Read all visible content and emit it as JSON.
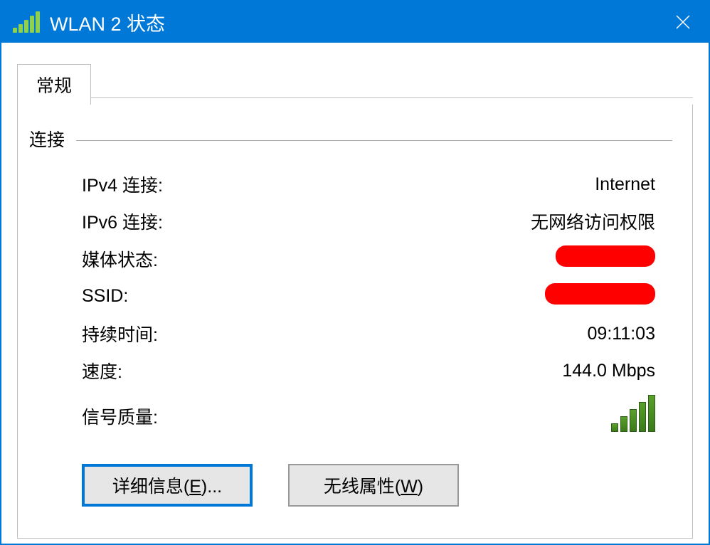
{
  "title": "WLAN 2 状态",
  "tab": {
    "general": "常规"
  },
  "section": {
    "connection": "连接"
  },
  "fields": {
    "ipv4_label": "IPv4 连接:",
    "ipv4_value": "Internet",
    "ipv6_label": "IPv6 连接:",
    "ipv6_value": "无网络访问权限",
    "media_label": "媒体状态:",
    "media_value_redacted": true,
    "ssid_label": "SSID:",
    "ssid_value_redacted": true,
    "duration_label": "持续时间:",
    "duration_value": "09:11:03",
    "speed_label": "速度:",
    "speed_value": "144.0 Mbps",
    "signal_label": "信号质量:"
  },
  "buttons": {
    "details_prefix": "详细信息(",
    "details_key": "E",
    "details_suffix": ")...",
    "wireless_prefix": "无线属性(",
    "wireless_key": "W",
    "wireless_suffix": ")"
  }
}
